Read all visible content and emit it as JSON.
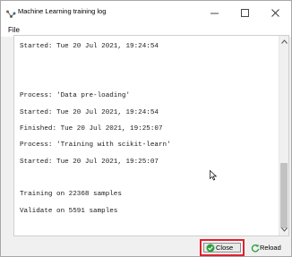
{
  "window": {
    "title": "Machine Learning training log"
  },
  "menu": {
    "file_label": "File"
  },
  "log": {
    "lines": [
      "Started: Tue 20 Jul 2021, 19:24:54",
      "",
      "",
      "Process: 'Data pre-loading'",
      "Started: Tue 20 Jul 2021, 19:24:54",
      "Finished: Tue 20 Jul 2021, 19:25:07",
      "Process: 'Training with scikit-learn'",
      "Started: Tue 20 Jul 2021, 19:25:07",
      "",
      "Training on 22368 samples",
      "Validate on 5591 samples"
    ]
  },
  "buttons": {
    "close_label": "Close",
    "reload_label": "Reload"
  },
  "colors": {
    "highlight": "#e0202f",
    "close_icon": "#2e9e3a",
    "reload_icon": "#2e9e3a"
  },
  "icons": {
    "app": "app-icon",
    "minimize": "minimize-icon",
    "maximize": "maximize-icon",
    "window_close": "window-close-icon",
    "close_button": "checkmark-icon",
    "reload_button": "refresh-icon",
    "cursor": "cursor-icon"
  }
}
